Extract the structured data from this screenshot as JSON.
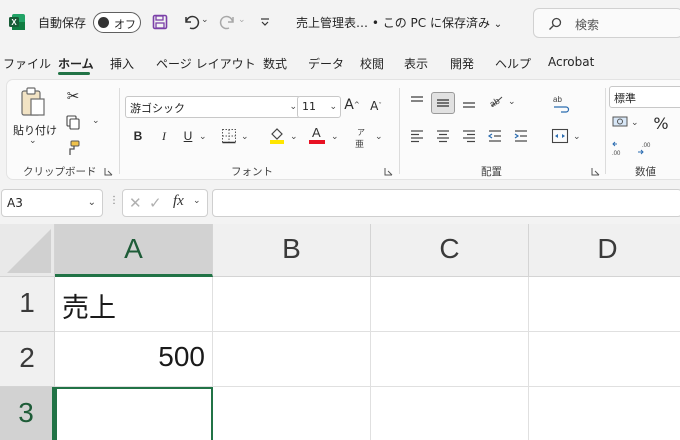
{
  "titlebar": {
    "autosave_label": "自動保存",
    "autosave_state": "オフ",
    "document_title": "売上管理表… • この PC に保存済み",
    "search_placeholder": "検索"
  },
  "tabs": [
    "ファイル",
    "ホーム",
    "挿入",
    "ページ レイアウト",
    "数式",
    "データ",
    "校閲",
    "表示",
    "開発",
    "ヘルプ",
    "Acrobat"
  ],
  "active_tab": "ホーム",
  "ribbon": {
    "clipboard": {
      "paste_label": "貼り付け",
      "group_label": "クリップボード"
    },
    "font": {
      "font_name": "游ゴシック",
      "font_size": "11",
      "grow_label": "A",
      "shrink_label": "A",
      "bold_label": "B",
      "italic_label": "I",
      "underline_label": "U",
      "font_color_label": "A",
      "phonetic_label": "ア",
      "group_label": "フォント"
    },
    "alignment": {
      "group_label": "配置"
    },
    "number": {
      "format": "標準",
      "percent_label": "%",
      "group_label": "数値"
    }
  },
  "formula_bar": {
    "name_box": "A3",
    "fx_label": "fx",
    "formula": ""
  },
  "grid": {
    "columns": [
      "A",
      "B",
      "C",
      "D"
    ],
    "selected_column": "A",
    "rows": [
      {
        "num": "1",
        "cells": [
          "売上",
          "",
          "",
          ""
        ]
      },
      {
        "num": "2",
        "cells": [
          "500",
          "",
          "",
          ""
        ]
      },
      {
        "num": "3",
        "cells": [
          "",
          "",
          "",
          ""
        ]
      }
    ],
    "selected_row": "3",
    "active_cell": "A3"
  },
  "colors": {
    "accent": "#217346",
    "titlebar_bg": "#f3f3f3",
    "header_bg": "#f0f0f0",
    "selected_header_bg": "#d2d2d2",
    "font_color_bar": "#e81123",
    "highlight_bar": "#ffe600"
  }
}
